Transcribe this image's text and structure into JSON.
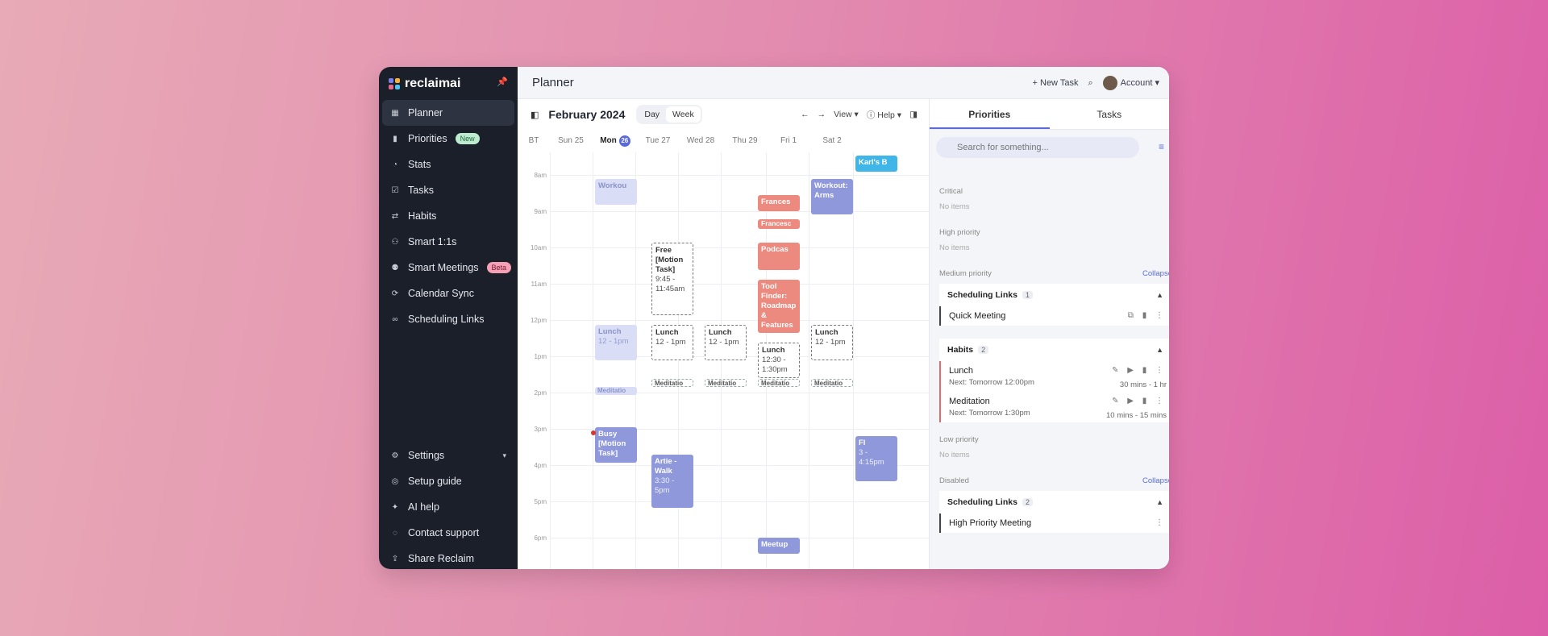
{
  "app": {
    "logo_text": "reclaimai"
  },
  "sidebar": {
    "items": [
      {
        "label": "Planner",
        "icon": "calendar-icon",
        "badge": ""
      },
      {
        "label": "Priorities",
        "icon": "bars-icon",
        "badge": "New"
      },
      {
        "label": "Stats",
        "icon": "stats-icon",
        "badge": ""
      },
      {
        "label": "Tasks",
        "icon": "checkbox-icon",
        "badge": ""
      },
      {
        "label": "Habits",
        "icon": "repeat-icon",
        "badge": ""
      },
      {
        "label": "Smart 1:1s",
        "icon": "people-icon",
        "badge": ""
      },
      {
        "label": "Smart Meetings",
        "icon": "group-icon",
        "badge": "Beta"
      },
      {
        "label": "Calendar Sync",
        "icon": "sync-icon",
        "badge": ""
      },
      {
        "label": "Scheduling Links",
        "icon": "link-icon",
        "badge": ""
      }
    ],
    "bottom": [
      {
        "label": "Settings",
        "icon": "gear-icon"
      },
      {
        "label": "Setup guide",
        "icon": "compass-icon"
      },
      {
        "label": "AI help",
        "icon": "sparkle-icon"
      },
      {
        "label": "Contact support",
        "icon": "support-icon"
      },
      {
        "label": "Share Reclaim",
        "icon": "share-icon"
      }
    ]
  },
  "topbar": {
    "title": "Planner",
    "new_task": "New Task",
    "account": "Account"
  },
  "calendar": {
    "month": "February 2024",
    "view_day": "Day",
    "view_week": "Week",
    "view_menu": "View",
    "help_menu": "Help",
    "tz": "BT",
    "days": [
      "Sun 25",
      "Mon",
      "Tue 27",
      "Wed 28",
      "Thu 29",
      "Fri 1",
      "Sat 2"
    ],
    "today_num": "26",
    "hours": [
      "8am",
      "9am",
      "10am",
      "11am",
      "12pm",
      "1pm",
      "2pm",
      "3pm",
      "4pm",
      "5pm",
      "6pm"
    ],
    "events": {
      "workout_mon": "Workou",
      "workout_fri_title": "Workout: Arms",
      "francesca1": "Frances",
      "francesca2": "Francesc",
      "podcast": "Podcas",
      "tool_finder": "Tool Finder: Roadmap & Features",
      "free_title": "Free [Motion Task]",
      "free_time": "9:45 - 11:45am",
      "lunch": "Lunch",
      "lunch_time": "12 - 1pm",
      "lunch_thu_time": "12:30 - 1:30pm",
      "meditation": "Meditatio",
      "busy_title": "Busy [Motion Task]",
      "artie_title": "Artie - Walk",
      "artie_time": "3:30 - 5pm",
      "sat_title": "Fl",
      "sat_time": "3 - 4:15pm",
      "karl": "Karl's B",
      "thu_bottom": "Meetup"
    }
  },
  "right": {
    "tab_priorities": "Priorities",
    "tab_tasks": "Tasks",
    "search_placeholder": "Search for something...",
    "critical": "Critical",
    "no_items": "No items",
    "high": "High priority",
    "medium": "Medium priority",
    "collapse": "Collapse",
    "sched_links": "Scheduling Links",
    "sched_count": "1",
    "quick_meeting": "Quick Meeting",
    "habits": "Habits",
    "habits_count": "2",
    "lunch": "Lunch",
    "lunch_next": "Next: Tomorrow 12:00pm",
    "lunch_dur": "30 mins - 1 hr",
    "meditation": "Meditation",
    "med_next": "Next: Tomorrow 1:30pm",
    "med_dur": "10 mins - 15 mins",
    "low": "Low priority",
    "disabled": "Disabled",
    "disabled_links_count": "2",
    "high_priority_meeting": "High Priority Meeting"
  }
}
